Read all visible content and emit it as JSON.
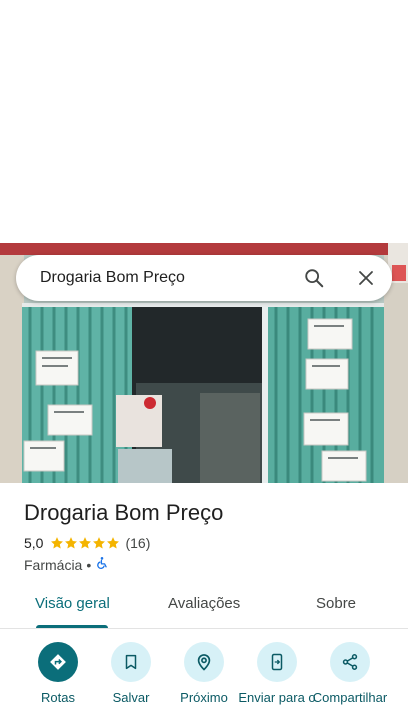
{
  "search": {
    "query": "Drogaria Bom Preço",
    "search_icon": "search-icon",
    "close_icon": "close-icon"
  },
  "place": {
    "name": "Drogaria Bom Preço",
    "rating": "5,0",
    "stars": 5,
    "review_count": "(16)",
    "category": "Farmácia",
    "separator": "•",
    "accessibility_icon": "wheelchair-icon"
  },
  "tabs": [
    {
      "label": "Visão geral",
      "active": true
    },
    {
      "label": "Avaliações",
      "active": false
    },
    {
      "label": "Sobre",
      "active": false
    }
  ],
  "actions": [
    {
      "label": "Rotas",
      "icon": "directions-icon"
    },
    {
      "label": "Salvar",
      "icon": "bookmark-icon"
    },
    {
      "label": "Próximo",
      "icon": "nearby-icon"
    },
    {
      "label": "Enviar para o",
      "icon": "send-to-phone-icon"
    },
    {
      "label": "Compartilhar",
      "icon": "share-icon"
    }
  ],
  "colors": {
    "accent": "#0b6e7a",
    "action_bg": "#d7f1f7",
    "star": "#f4b400"
  }
}
